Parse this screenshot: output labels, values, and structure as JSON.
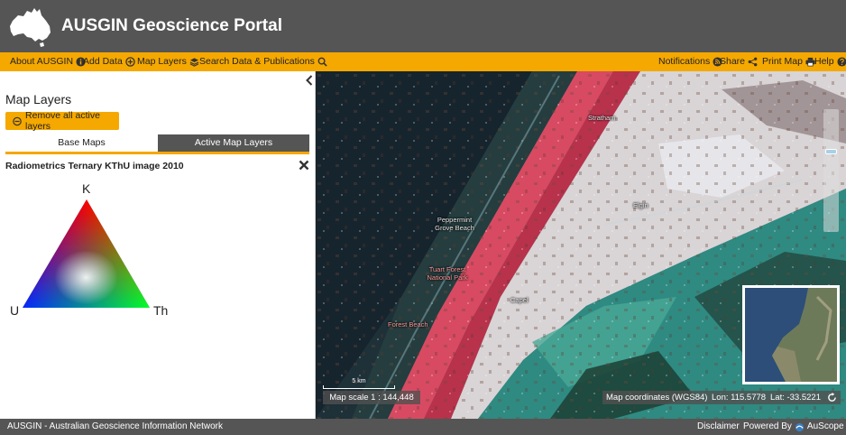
{
  "app": {
    "title": "AUSGIN Geoscience Portal"
  },
  "nav": {
    "left": [
      {
        "label": "About AUSGIN",
        "icon": "info-icon"
      },
      {
        "label": "Add Data",
        "icon": "plus-circle-icon"
      },
      {
        "label": "Map Layers",
        "icon": "layers-icon"
      },
      {
        "label": "Search Data & Publications",
        "icon": "search-icon"
      }
    ],
    "right": [
      {
        "label": "Notifications",
        "icon": "rss-icon"
      },
      {
        "label": "Share",
        "icon": "share-icon"
      },
      {
        "label": "Print Map",
        "icon": "print-icon"
      },
      {
        "label": "Help",
        "icon": "help-icon"
      }
    ]
  },
  "panel": {
    "title": "Map Layers",
    "remove_label": "Remove all active layers",
    "tabs": {
      "base": "Base Maps",
      "active": "Active Map Layers"
    },
    "layer": {
      "title": "Radiometrics Ternary KThU image 2010",
      "legend": {
        "top": "K",
        "left": "U",
        "right": "Th"
      }
    }
  },
  "map": {
    "towns": {
      "stratham": "Stratham",
      "elgin": "Elgin",
      "peppermint": "Peppermint Grove Beach",
      "tuart": "Tuart Forest National Park",
      "capel": "Capel",
      "forest_beach": "Forest Beach"
    },
    "scale_bar_label": "5 km",
    "map_scale": "Map scale 1 : 144,448",
    "coordinates": {
      "label": "Map coordinates (WGS84)",
      "lon": "Lon: 115.5778",
      "lat": "Lat: -33.5221"
    }
  },
  "footer": {
    "left": "AUSGIN - Australian Geoscience Information Network",
    "disclaimer": "Disclaimer",
    "powered_by": "Powered By",
    "powered_by_brand": "AuScope"
  },
  "colors": {
    "header_bg": "#555555",
    "accent": "#f5a800",
    "footer_bg": "#555555"
  }
}
